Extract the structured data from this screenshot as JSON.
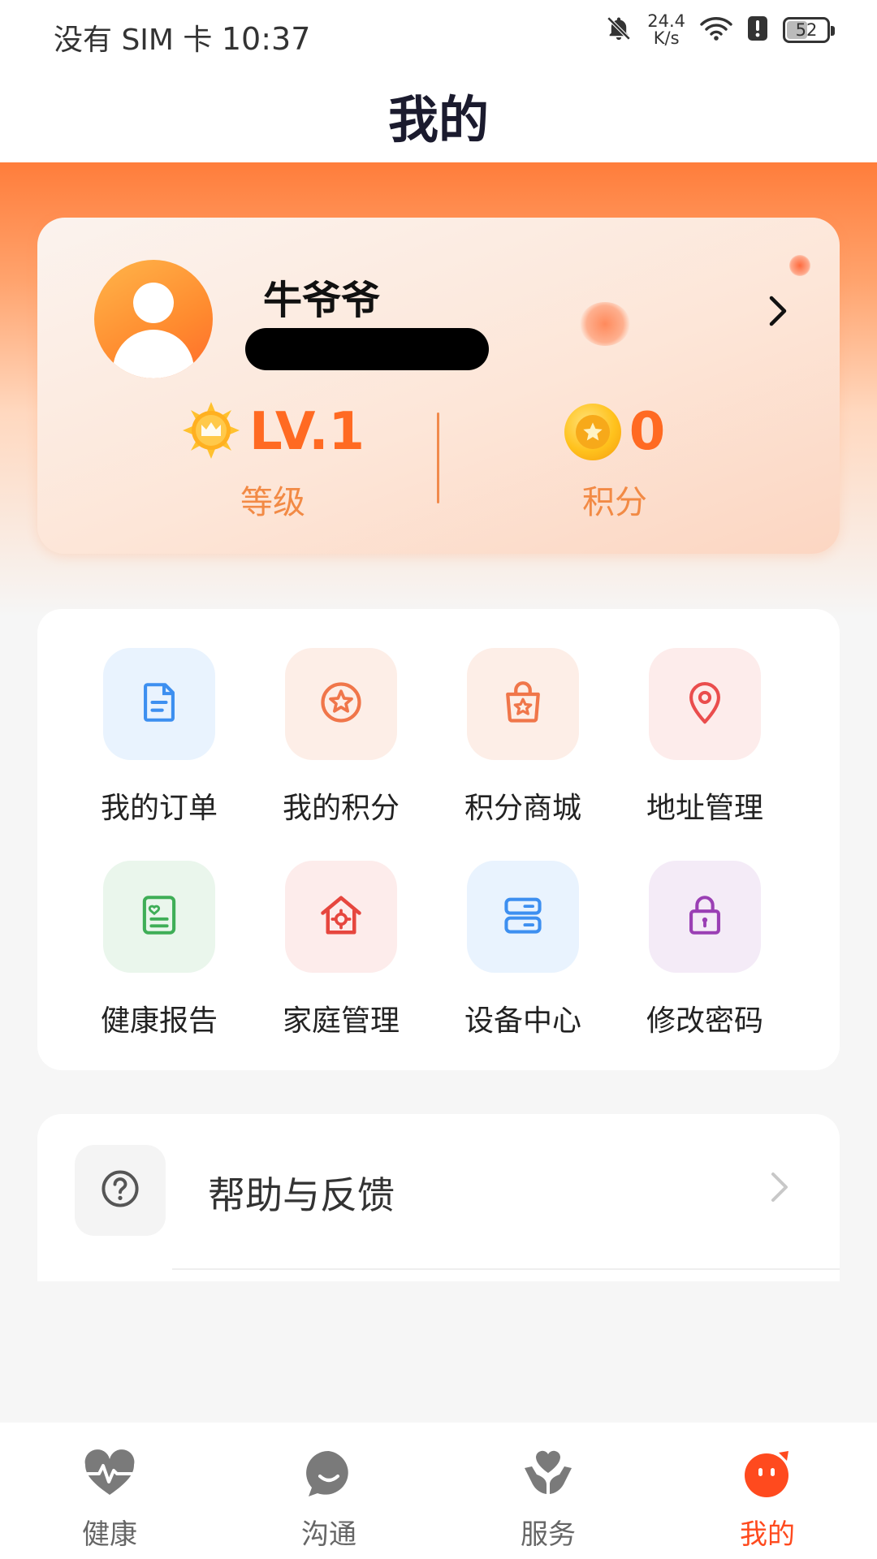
{
  "status_bar": {
    "carrier": "没有 SIM 卡",
    "time": "10:37",
    "net_speed_value": "24.4",
    "net_speed_unit": "K/s",
    "battery": "52",
    "battery_level": 0.52
  },
  "header": {
    "title": "我的"
  },
  "profile": {
    "name": "牛爷爷",
    "level_value": "LV.1",
    "level_label": "等级",
    "points_value": "0",
    "points_label": "积分"
  },
  "menu": {
    "items": [
      {
        "label": "我的订单",
        "icon": "document-icon",
        "color": "#3d8ff0",
        "bg": "#e9f3fe"
      },
      {
        "label": "我的积分",
        "icon": "star-circle-icon",
        "color": "#f0764a",
        "bg": "#fdeee7"
      },
      {
        "label": "积分商城",
        "icon": "shopping-bag-star-icon",
        "color": "#f0764a",
        "bg": "#fdeee7"
      },
      {
        "label": "地址管理",
        "icon": "location-pin-icon",
        "color": "#ea4d4d",
        "bg": "#fdeceb"
      },
      {
        "label": "健康报告",
        "icon": "health-report-icon",
        "color": "#3fae57",
        "bg": "#eaf6ec"
      },
      {
        "label": "家庭管理",
        "icon": "home-gear-icon",
        "color": "#e6463e",
        "bg": "#fdeceb"
      },
      {
        "label": "设备中心",
        "icon": "server-device-icon",
        "color": "#3d8ff0",
        "bg": "#e9f3fe"
      },
      {
        "label": "修改密码",
        "icon": "lock-icon",
        "color": "#9a3fb4",
        "bg": "#f4ebf7"
      }
    ]
  },
  "help": {
    "label": "帮助与反馈",
    "icon": "question-circle-icon"
  },
  "tabs": [
    {
      "label": "健康",
      "icon": "heart-pulse-icon",
      "active": false
    },
    {
      "label": "沟通",
      "icon": "chat-bubble-icon",
      "active": false
    },
    {
      "label": "服务",
      "icon": "hands-heart-icon",
      "active": false
    },
    {
      "label": "我的",
      "icon": "smile-face-icon",
      "active": true
    }
  ],
  "colors": {
    "accent": "#ff6a22",
    "tab_active": "#ff4a1e",
    "tab_inactive": "#7a7a7a"
  }
}
